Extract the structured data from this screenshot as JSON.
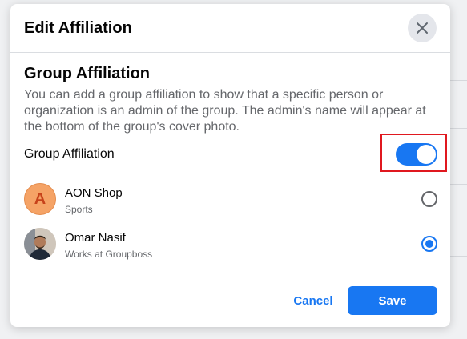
{
  "modal": {
    "title": "Edit Affiliation",
    "close_icon": "close-icon"
  },
  "section": {
    "title": "Group Affiliation",
    "description": "You can add a group affiliation to show that a specific person or organization is an admin of the group. The admin's name will appear at the bottom of the group's cover photo."
  },
  "toggle": {
    "label": "Group Affiliation",
    "on": true,
    "color": "#1877f2",
    "highlight_color": "#e0181f"
  },
  "options": [
    {
      "initial": "A",
      "name": "AON Shop",
      "subtitle": "Sports",
      "selected": false,
      "avatar": "letter-avatar"
    },
    {
      "name": "Omar Nasif",
      "subtitle": "Works at Groupboss",
      "selected": true,
      "avatar": "photo-avatar"
    }
  ],
  "footer": {
    "cancel_label": "Cancel",
    "save_label": "Save"
  }
}
